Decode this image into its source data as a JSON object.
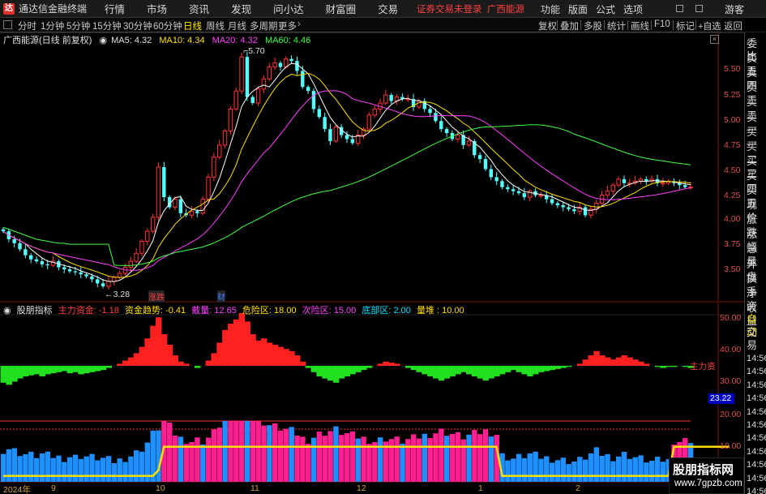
{
  "app": {
    "title": "通达信金融终端",
    "logo_letter": "达",
    "menu": [
      "行情",
      "市场",
      "资讯",
      "发现",
      "问小达",
      "财富圈",
      "交易"
    ],
    "notice": "证券交易未登录",
    "stock_tab": "广西能源",
    "right_menu": [
      "功能",
      "版面",
      "公式",
      "选项"
    ],
    "guest": "游客"
  },
  "toolbar": {
    "periods": [
      "分时",
      "1分钟",
      "5分钟",
      "15分钟",
      "30分钟",
      "60分钟",
      "日线",
      "周线",
      "月线",
      "多周期",
      "更多"
    ],
    "active": "日线",
    "tools": [
      "复权",
      "叠加",
      "多股",
      "统计",
      "画线",
      "F10",
      "标记",
      "+自选",
      "返回"
    ]
  },
  "main_header": {
    "stock": "广西能源(日线 前复权)",
    "ma5": "MA5: 4.32",
    "ma10": "MA10: 4.34",
    "ma20": "MA20: 4.32",
    "ma60": "MA60: 4.46"
  },
  "price_axis": [
    "5.50",
    "5.25",
    "5.00",
    "4.75",
    "4.50",
    "4.25",
    "4.00",
    "3.75",
    "3.50"
  ],
  "annotations": {
    "high": "5.70",
    "low": "3.28",
    "tag1": "涨跌",
    "tag2": "财"
  },
  "indicator_header": {
    "name": "股朋指标",
    "main_fund": "主力资金: -1.18",
    "fund_trend": "资金趋势: -0.41",
    "volume": "戴量: 12.65",
    "danger": "危险区: 18.00",
    "second": "次险区: 15.00",
    "bottom": "底部区: 2.00",
    "stack": "量堆 : 10.00"
  },
  "indicator_axis": [
    "50.00",
    "40.00",
    "30.00",
    "20.00",
    "10.00"
  ],
  "indicator_value_box": "23.22",
  "main_fund_label": "主力资",
  "x_axis": [
    "2024年",
    "9",
    "10",
    "11",
    "12",
    "1",
    "2"
  ],
  "right_panel": {
    "labels": [
      "委比",
      "卖五",
      "卖四",
      "卖三",
      "卖二",
      "卖一",
      "买一",
      "买二",
      "买三",
      "买四",
      "买五",
      "现价",
      "涨跌",
      "涨幅",
      "总量",
      "外盘",
      "换手",
      "净资",
      "收益"
    ],
    "bottom_labels": [
      "自动",
      "交易"
    ],
    "times": [
      "14:56",
      "14:56",
      "14:56",
      "14:56",
      "14:56",
      "14:56",
      "14:56",
      "14:56",
      "14:56",
      "14:56",
      "14:56"
    ]
  },
  "watermark": {
    "title": "股朋指标网",
    "url": "www.7gpzb.com"
  },
  "colors": {
    "up": "#ff3232",
    "down": "#54ffff",
    "ma5": "#ffffff",
    "ma10": "#ffe000",
    "ma20": "#ff40ff",
    "ma60": "#40ff40",
    "pink": "#ff1f8f",
    "blue": "#1e90ff"
  },
  "chart_data": {
    "type": "candlestick",
    "ylim": [
      3.25,
      5.8
    ],
    "closes": [
      3.88,
      3.8,
      3.76,
      3.7,
      3.64,
      3.6,
      3.58,
      3.55,
      3.54,
      3.58,
      3.52,
      3.5,
      3.48,
      3.47,
      3.45,
      3.43,
      3.4,
      3.36,
      3.33,
      3.38,
      3.42,
      3.46,
      3.52,
      3.58,
      3.66,
      3.78,
      3.88,
      4.02,
      4.52,
      4.22,
      4.12,
      4.2,
      4.06,
      4.04,
      4.08,
      4.06,
      4.2,
      4.42,
      4.62,
      4.74,
      4.88,
      5.1,
      5.28,
      5.62,
      5.22,
      5.16,
      5.3,
      5.4,
      5.52,
      5.56,
      5.52,
      5.6,
      5.58,
      5.48,
      5.32,
      5.28,
      5.1,
      5.02,
      4.9,
      4.78,
      4.92,
      4.84,
      4.8,
      4.76,
      4.84,
      4.9,
      5.04,
      5.1,
      5.16,
      5.24,
      5.18,
      5.22,
      5.2,
      5.2,
      5.12,
      5.18,
      5.1,
      5.06,
      4.98,
      4.9,
      4.86,
      4.8,
      4.84,
      4.74,
      4.78,
      4.64,
      4.6,
      4.5,
      4.42,
      4.38,
      4.32,
      4.3,
      4.28,
      4.26,
      4.22,
      4.28,
      4.24,
      4.24,
      4.2,
      4.16,
      4.14,
      4.12,
      4.1,
      4.08,
      4.12,
      4.04,
      4.1,
      4.16,
      4.24,
      4.28,
      4.34,
      4.4,
      4.36,
      4.36,
      4.38,
      4.4,
      4.38,
      4.4,
      4.36,
      4.36,
      4.38,
      4.36,
      4.34,
      4.32,
      4.32
    ],
    "main_fund": [
      -16,
      -18,
      -15,
      -12,
      -10,
      -9,
      -8,
      -10,
      -8,
      -7,
      -6,
      -5,
      -7,
      -6,
      -8,
      -7,
      -6,
      -5,
      -4,
      -2,
      0,
      2,
      5,
      8,
      12,
      18,
      26,
      38,
      46,
      30,
      20,
      10,
      4,
      2,
      0,
      -2,
      0,
      5,
      12,
      22,
      34,
      40,
      44,
      50,
      42,
      30,
      24,
      26,
      22,
      20,
      18,
      16,
      14,
      10,
      4,
      -2,
      -6,
      -10,
      -12,
      -14,
      -16,
      -12,
      -10,
      -8,
      -6,
      -4,
      -2,
      0,
      2,
      4,
      3,
      2,
      0,
      -2,
      -4,
      -6,
      -8,
      -10,
      -12,
      -14,
      -12,
      -10,
      -8,
      -6,
      -8,
      -10,
      -12,
      -14,
      -12,
      -10,
      -8,
      -6,
      -4,
      -6,
      -8,
      -10,
      -8,
      -6,
      -5,
      -4,
      -3,
      -2,
      -1,
      0,
      2,
      6,
      10,
      14,
      10,
      8,
      6,
      8,
      10,
      8,
      6,
      4,
      2,
      0,
      -1,
      -2,
      -1,
      -1,
      0,
      -1,
      -2
    ],
    "fund_trend": [
      6,
      6,
      6,
      6,
      6,
      6,
      6,
      6,
      6,
      6,
      6,
      6,
      6,
      6,
      6,
      6,
      6,
      6,
      6,
      6,
      6,
      6,
      6,
      6,
      6,
      6,
      6,
      6,
      12,
      36,
      36,
      36,
      36,
      36,
      36,
      36,
      36,
      36,
      36,
      36,
      36,
      36,
      36,
      36,
      36,
      36,
      36,
      36,
      36,
      36,
      36,
      36,
      36,
      36,
      36,
      36,
      36,
      36,
      36,
      36,
      36,
      36,
      36,
      36,
      36,
      36,
      36,
      36,
      36,
      36,
      36,
      36,
      36,
      36,
      36,
      36,
      36,
      36,
      36,
      36,
      36,
      36,
      36,
      36,
      36,
      36,
      36,
      36,
      36,
      36,
      6,
      6,
      6,
      6,
      6,
      6,
      6,
      6,
      6,
      6,
      6,
      6,
      6,
      6,
      6,
      6,
      6,
      6,
      6,
      6,
      6,
      6,
      6,
      6,
      6,
      6,
      6,
      6,
      6,
      6,
      6,
      36,
      36,
      36,
      36,
      36,
      36,
      36,
      36,
      36,
      36,
      36
    ]
  }
}
